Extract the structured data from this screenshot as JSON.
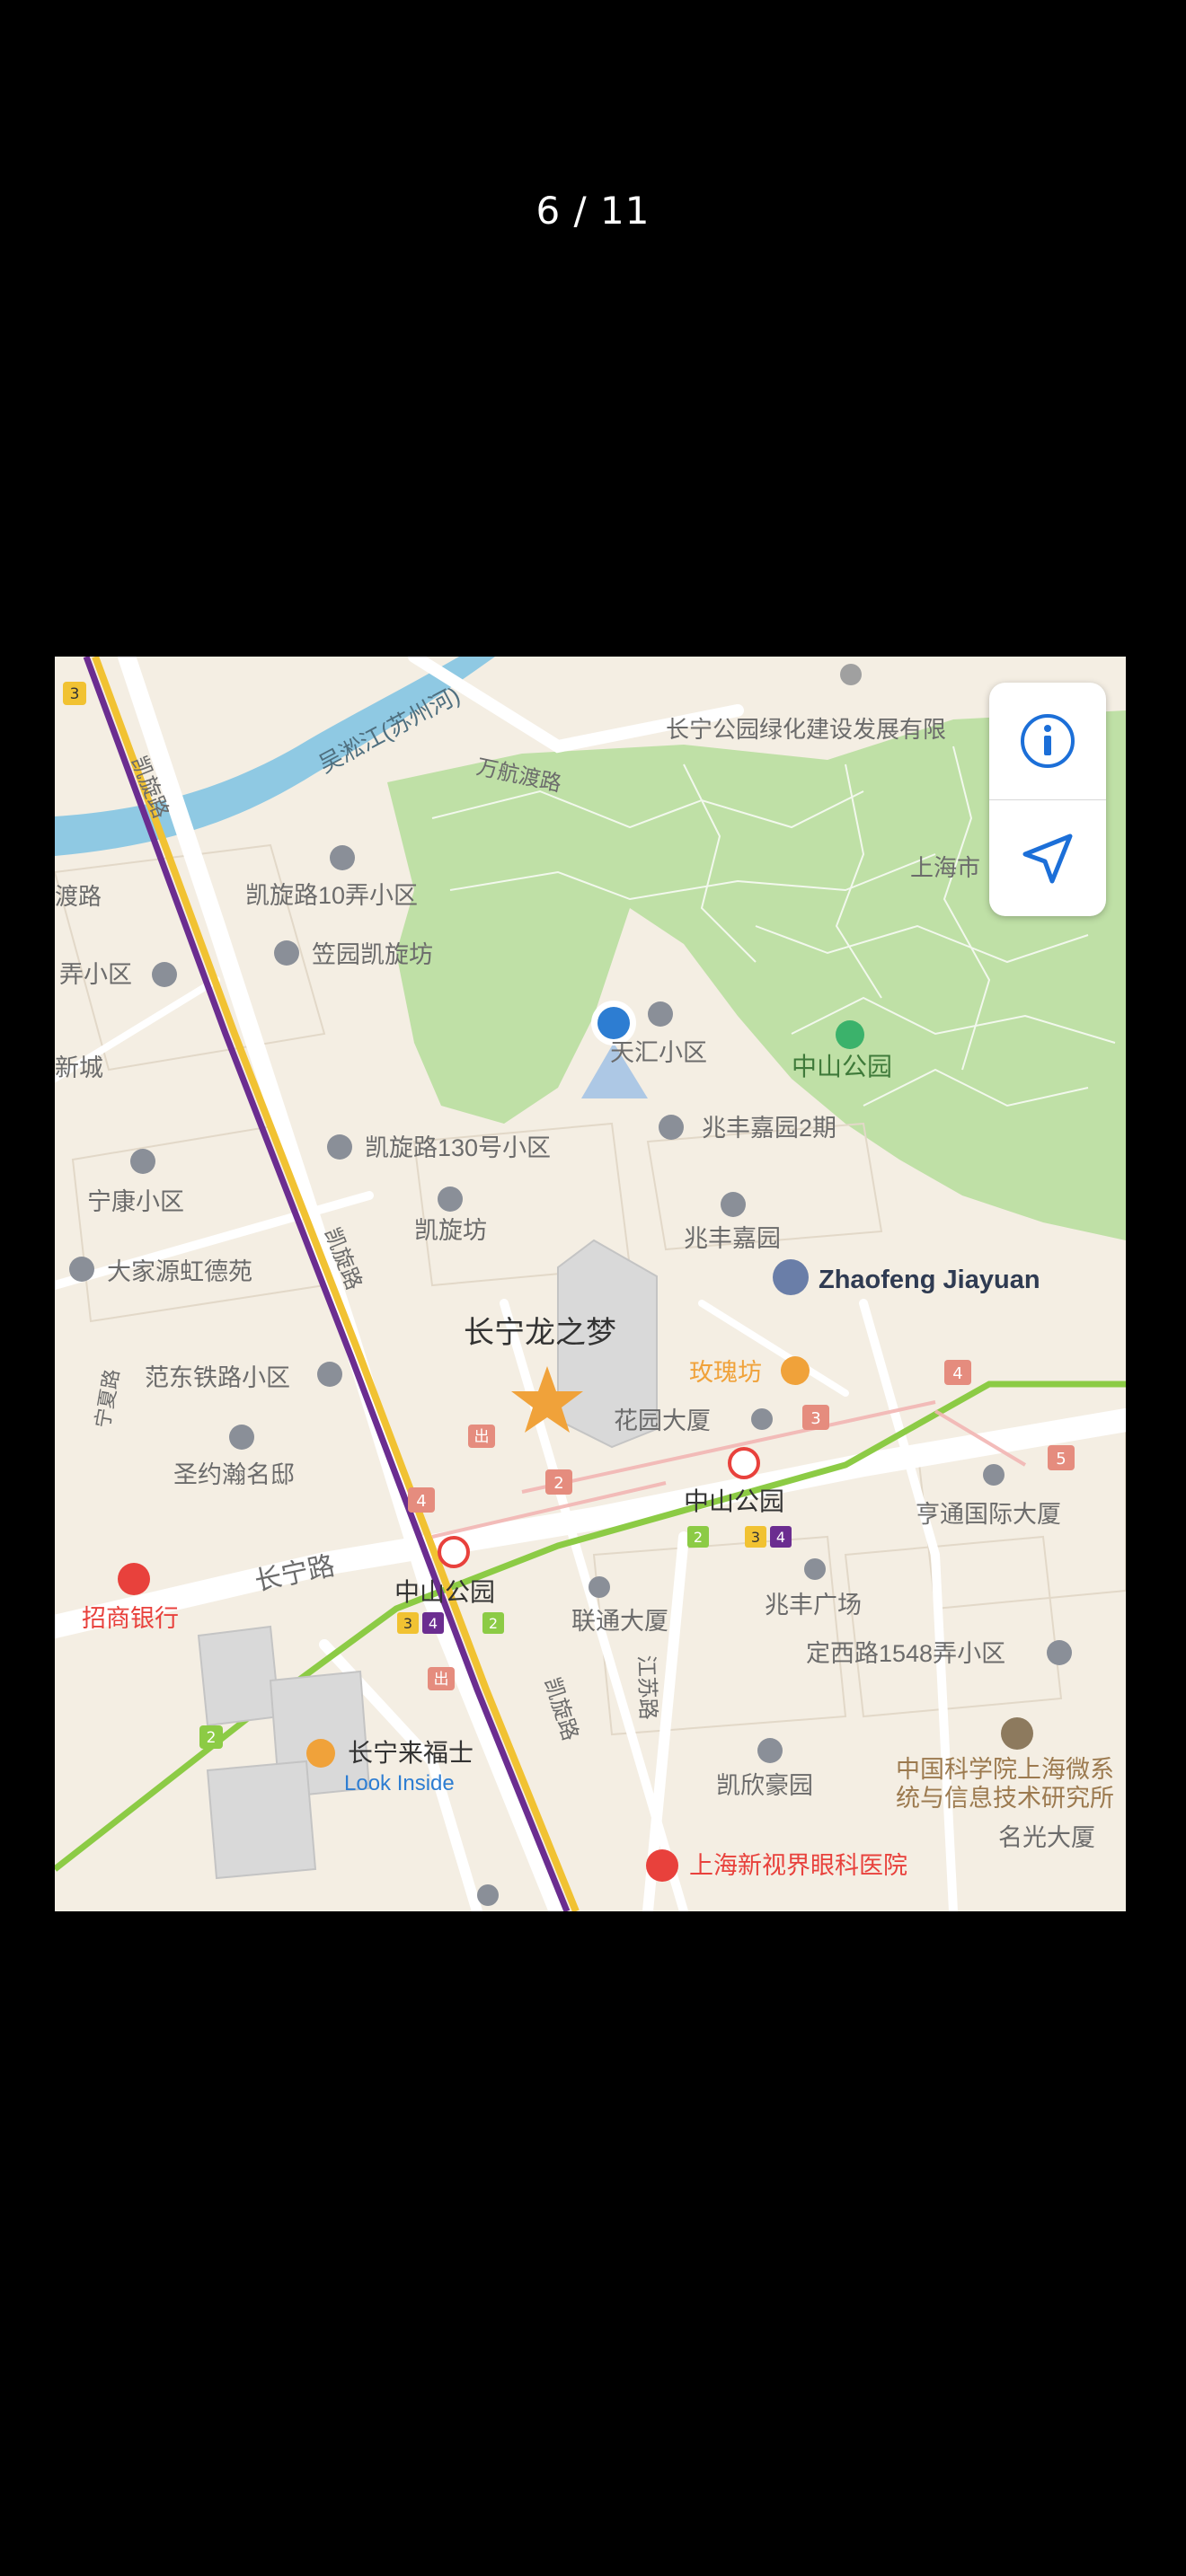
{
  "viewer": {
    "counter": "6 / 11"
  },
  "map": {
    "labels": {
      "river": "吴淞江(苏州河)",
      "wanhang": "万航渡路",
      "kaixuan_road": "凯旋路",
      "kaixuan_road2": "凯旋路",
      "kaixuan_road3": "凯旋路",
      "dujia": "渡路",
      "changning_greening": "长宁公园绿化建设发展有限",
      "shanghai_city": "上海市",
      "kaixuan10": "凯旋路10弄小区",
      "liyuan": "笠园凯旋坊",
      "nong": "弄小区",
      "xincheng": "新城",
      "tianhui": "天汇小区",
      "zhongshan_park": "中山公园",
      "zhaofeng2": "兆丰嘉园2期",
      "kaixuan130": "凯旋路130号小区",
      "ningkang": "宁康小区",
      "kaixuanfang": "凯旋坊",
      "zhaofengjiayuan": "兆丰嘉园",
      "zhaofeng_en": "Zhaofeng Jiayuan",
      "dajiayuan": "大家源虹德苑",
      "dragon_dream": "长宁龙之梦",
      "meiguifang": "玫瑰坊",
      "fandong": "范东铁路小区",
      "huayuan": "花园大厦",
      "ningxia_road": "宁夏路",
      "shengyue": "圣约瀚名邸",
      "zhongshan_station_r": "中山公园",
      "hengtong": "亨通国际大厦",
      "changning_road": "长宁路",
      "zhongshan_station_l": "中山公园",
      "zhaofeng_square": "兆丰广场",
      "cmb": "招商银行",
      "liantong": "联通大厦",
      "dingxi1548": "定西路1548弄小区",
      "kaixuan_lu_s": "凯旋路",
      "jiangsu_road": "江苏路",
      "raffles": "长宁来福士",
      "look_inside": "Look Inside",
      "kaixinhaoyuan": "凯欣豪园",
      "cas1": "中国科学院上海微系",
      "cas2": "统与信息技术研究所",
      "mingguang": "名光大厦",
      "eye_hospital": "上海新视界眼科医院",
      "exit": "出",
      "line2": "2",
      "line3": "3",
      "line4": "4",
      "entr2": "2",
      "entr3": "3",
      "entr4": "4",
      "entr5": "5"
    },
    "colors": {
      "land": "#f4eee3",
      "park": "#bfe0a6",
      "road": "#ffffff",
      "river": "#8fc9e3",
      "line2": "#8ccb45",
      "line3": "#f1c232",
      "line4": "#6b2d90",
      "metro_red": "#e8413c",
      "user": "#2d7dd2",
      "poi_gray": "#8a8f98",
      "poi_orange": "#f0a23a"
    }
  },
  "controls": {
    "info": "info-icon",
    "locate": "location-arrow-icon"
  }
}
